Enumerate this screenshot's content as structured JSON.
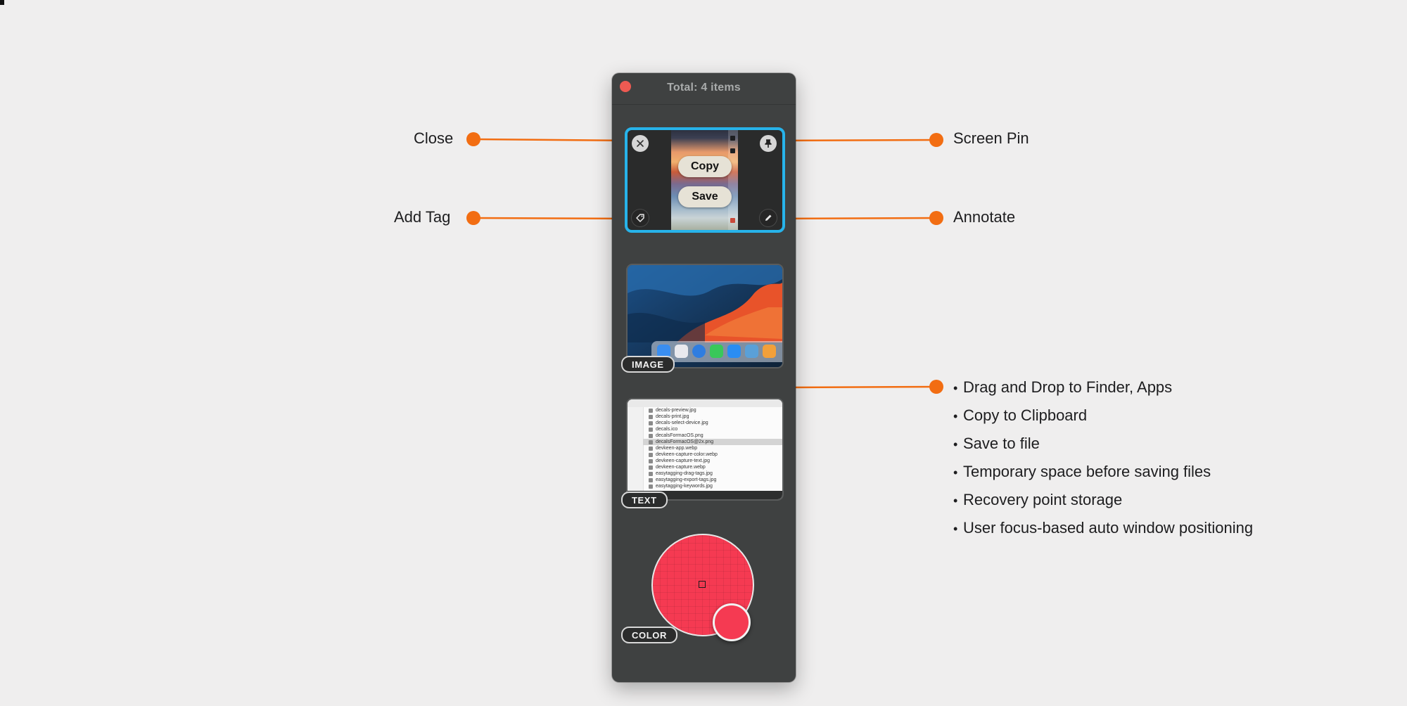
{
  "window": {
    "title": "Total: 4 items"
  },
  "screenshot_card": {
    "copy_label": "Copy",
    "save_label": "Save",
    "icons": [
      "close-icon",
      "pin-icon",
      "tag-icon",
      "pencil-icon"
    ]
  },
  "image_card": {
    "badge": "IMAGE"
  },
  "text_card": {
    "badge": "TEXT",
    "files": [
      "decals-preview.jpg",
      "decals-print.jpg",
      "decals-select-device.jpg",
      "decals.ico",
      "decalsFormacOS.png",
      "decalsFormacOS@2x.png",
      "devkeen-app.webp",
      "devkeen-capture-color.webp",
      "devkeen-capture-text.jpg",
      "devkeen-capture.webp",
      "easytagging-drag-tags.jpg",
      "easytagging-export-tags.jpg",
      "easytagging-keywords.jpg"
    ]
  },
  "color_card": {
    "badge": "COLOR",
    "color": "#f53a52"
  },
  "callouts": {
    "close": "Close",
    "screen_pin": "Screen Pin",
    "add_tag": "Add Tag",
    "annotate": "Annotate"
  },
  "features": [
    "Drag and Drop to Finder, Apps",
    "Copy to Clipboard",
    "Save to file",
    "Temporary space before saving files",
    "Recovery point storage",
    "User focus-based auto window positioning"
  ],
  "colors": {
    "accent_orange": "#f26d12",
    "selection_blue": "#27b3ea",
    "panel_bg": "#3f4141",
    "page_bg": "#efeeee"
  }
}
